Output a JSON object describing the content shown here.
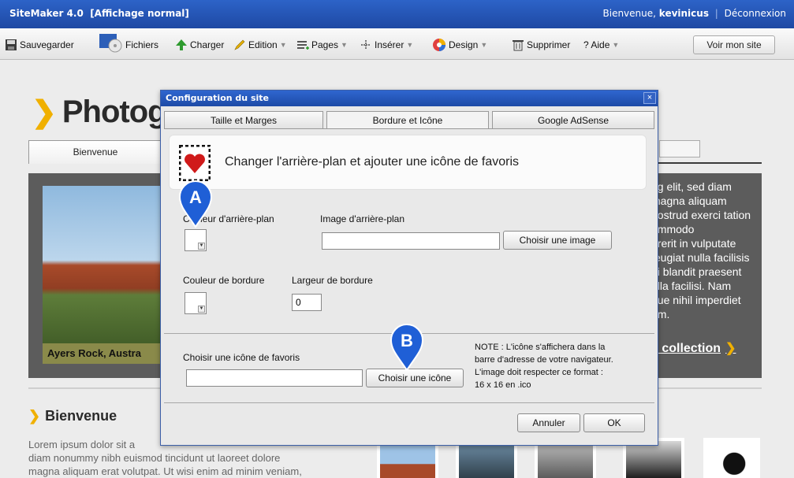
{
  "titlebar": {
    "app_title": "SiteMaker 4.0",
    "mode": "[Affichage normal]",
    "welcome_prefix": "Bienvenue,",
    "username": "kevinicus",
    "separator": "|",
    "logout": "Déconnexion"
  },
  "toolbar": {
    "save": "Sauvegarder",
    "files": "Fichiers",
    "upload": "Charger",
    "edit": "Edition",
    "pages": "Pages",
    "insert": "Insérer",
    "design": "Design",
    "delete": "Supprimer",
    "help": "? Aide",
    "view_site": "Voir mon site"
  },
  "background_page": {
    "title_fragment": "Photogr",
    "tab_home": "Bienvenue",
    "caption": "Ayers Rock, Austra",
    "side_text": [
      "ng elit, sed diam",
      "magna aliquam",
      "nostrud exerci tation",
      "ommodo",
      "drerit in vulputate",
      "feugiat nulla facilisis",
      "ui blandit praesent",
      "ulla facilisi. Nam",
      "gue nihil imperdiet",
      "um."
    ],
    "collection_link": "a collection",
    "section_heading": "Bienvenue",
    "paragraph": [
      "Lorem ipsum dolor sit a",
      "diam nonummy nibh euismod tincidunt ut laoreet dolore",
      "magna aliquam erat volutpat. Ut wisi enim ad minim veniam,"
    ]
  },
  "modal": {
    "title": "Configuration du site",
    "close": "×",
    "tabs": [
      "Taille et Marges",
      "Bordure et Icône",
      "Google AdSense"
    ],
    "active_tab": "Bordure et Icône",
    "header_text": "Changer l'arrière-plan et ajouter une icône de favoris",
    "bg_color_label": "Couleur d'arrière-plan",
    "bg_image_label": "Image d'arrière-plan",
    "bg_image_value": "",
    "choose_image_button": "Choisir une image",
    "border_color_label": "Couleur de bordure",
    "border_width_label": "Largeur de bordure",
    "border_width_value": "0",
    "favicon_label": "Choisir une icône de favoris",
    "favicon_value": "",
    "choose_icon_button": "Choisir une icône",
    "note_lines": [
      "NOTE : L'icône s'affichera dans la",
      "barre d'adresse de votre navigateur.",
      "L'image doit respecter ce format :",
      "16 x 16 en .ico"
    ],
    "cancel_button": "Annuler",
    "ok_button": "OK"
  },
  "markers": {
    "a": "A",
    "b": "B"
  },
  "colors": {
    "marker_blue": "#1f5fd6",
    "accent_yellow": "#f0b000",
    "titlebar_blue": "#2452b5"
  }
}
